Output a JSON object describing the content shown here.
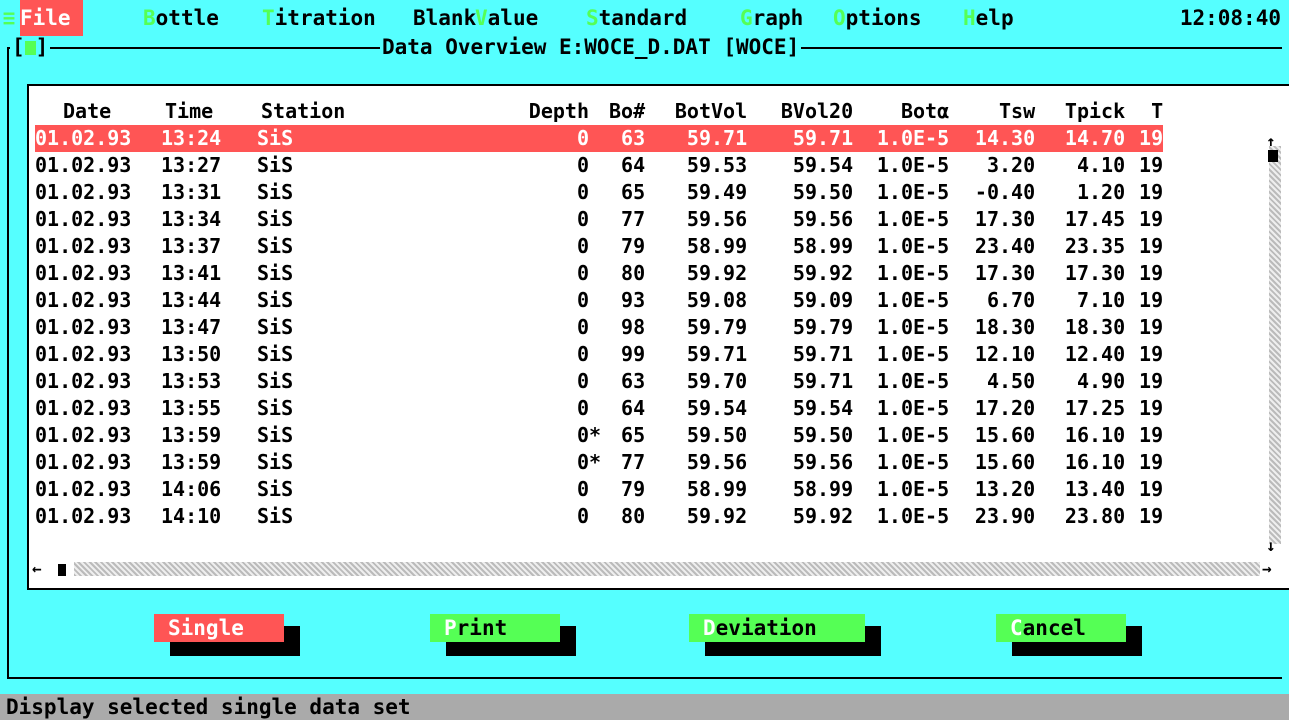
{
  "menu": {
    "sys_icon": "≡",
    "items": [
      {
        "hot": " ",
        "label": "File ",
        "active": true
      },
      {
        "hot": "B",
        "label": "ottle"
      },
      {
        "hot": "T",
        "label": "itration"
      },
      {
        "hot": "",
        "label": "Blank"
      },
      {
        "hot": "V",
        "label": "alue"
      },
      {
        "hot": "S",
        "label": "tandard"
      },
      {
        "hot": "G",
        "label": "raph"
      },
      {
        "hot": "O",
        "label": "ptions"
      },
      {
        "hot": "H",
        "label": "elp"
      }
    ],
    "clock": "12:08:40"
  },
  "dialog": {
    "title": "Data Overview E:WOCE_D.DAT [WOCE]"
  },
  "table": {
    "headers": [
      "Date",
      "Time",
      "Station",
      "Depth",
      "Bo#",
      "BotVol",
      "BVol20",
      "Botα",
      "Tsw",
      "Tpick",
      "T"
    ],
    "rows": [
      {
        "date": "01.02.93",
        "time": "13:24",
        "station": "SiS",
        "depth": "0",
        "flag": "",
        "bo": "63",
        "botvol": "59.71",
        "bvol20": "59.71",
        "bota": "1.0E-5",
        "tsw": "14.30",
        "tpick": "14.70",
        "t": "19"
      },
      {
        "date": "01.02.93",
        "time": "13:27",
        "station": "SiS",
        "depth": "0",
        "flag": "",
        "bo": "64",
        "botvol": "59.53",
        "bvol20": "59.54",
        "bota": "1.0E-5",
        "tsw": "3.20",
        "tpick": "4.10",
        "t": "19"
      },
      {
        "date": "01.02.93",
        "time": "13:31",
        "station": "SiS",
        "depth": "0",
        "flag": "",
        "bo": "65",
        "botvol": "59.49",
        "bvol20": "59.50",
        "bota": "1.0E-5",
        "tsw": "-0.40",
        "tpick": "1.20",
        "t": "19"
      },
      {
        "date": "01.02.93",
        "time": "13:34",
        "station": "SiS",
        "depth": "0",
        "flag": "",
        "bo": "77",
        "botvol": "59.56",
        "bvol20": "59.56",
        "bota": "1.0E-5",
        "tsw": "17.30",
        "tpick": "17.45",
        "t": "19"
      },
      {
        "date": "01.02.93",
        "time": "13:37",
        "station": "SiS",
        "depth": "0",
        "flag": "",
        "bo": "79",
        "botvol": "58.99",
        "bvol20": "58.99",
        "bota": "1.0E-5",
        "tsw": "23.40",
        "tpick": "23.35",
        "t": "19"
      },
      {
        "date": "01.02.93",
        "time": "13:41",
        "station": "SiS",
        "depth": "0",
        "flag": "",
        "bo": "80",
        "botvol": "59.92",
        "bvol20": "59.92",
        "bota": "1.0E-5",
        "tsw": "17.30",
        "tpick": "17.30",
        "t": "19"
      },
      {
        "date": "01.02.93",
        "time": "13:44",
        "station": "SiS",
        "depth": "0",
        "flag": "",
        "bo": "93",
        "botvol": "59.08",
        "bvol20": "59.09",
        "bota": "1.0E-5",
        "tsw": "6.70",
        "tpick": "7.10",
        "t": "19"
      },
      {
        "date": "01.02.93",
        "time": "13:47",
        "station": "SiS",
        "depth": "0",
        "flag": "",
        "bo": "98",
        "botvol": "59.79",
        "bvol20": "59.79",
        "bota": "1.0E-5",
        "tsw": "18.30",
        "tpick": "18.30",
        "t": "19"
      },
      {
        "date": "01.02.93",
        "time": "13:50",
        "station": "SiS",
        "depth": "0",
        "flag": "",
        "bo": "99",
        "botvol": "59.71",
        "bvol20": "59.71",
        "bota": "1.0E-5",
        "tsw": "12.10",
        "tpick": "12.40",
        "t": "19"
      },
      {
        "date": "01.02.93",
        "time": "13:53",
        "station": "SiS",
        "depth": "0",
        "flag": "",
        "bo": "63",
        "botvol": "59.70",
        "bvol20": "59.71",
        "bota": "1.0E-5",
        "tsw": "4.50",
        "tpick": "4.90",
        "t": "19"
      },
      {
        "date": "01.02.93",
        "time": "13:55",
        "station": "SiS",
        "depth": "0",
        "flag": "",
        "bo": "64",
        "botvol": "59.54",
        "bvol20": "59.54",
        "bota": "1.0E-5",
        "tsw": "17.20",
        "tpick": "17.25",
        "t": "19"
      },
      {
        "date": "01.02.93",
        "time": "13:59",
        "station": "SiS",
        "depth": "0",
        "flag": "*",
        "bo": "65",
        "botvol": "59.50",
        "bvol20": "59.50",
        "bota": "1.0E-5",
        "tsw": "15.60",
        "tpick": "16.10",
        "t": "19"
      },
      {
        "date": "01.02.93",
        "time": "13:59",
        "station": "SiS",
        "depth": "0",
        "flag": "*",
        "bo": "77",
        "botvol": "59.56",
        "bvol20": "59.56",
        "bota": "1.0E-5",
        "tsw": "15.60",
        "tpick": "16.10",
        "t": "19"
      },
      {
        "date": "01.02.93",
        "time": "14:06",
        "station": "SiS",
        "depth": "0",
        "flag": "",
        "bo": "79",
        "botvol": "58.99",
        "bvol20": "58.99",
        "bota": "1.0E-5",
        "tsw": "13.20",
        "tpick": "13.40",
        "t": "19"
      },
      {
        "date": "01.02.93",
        "time": "14:10",
        "station": "SiS",
        "depth": "0",
        "flag": "",
        "bo": "80",
        "botvol": "59.92",
        "bvol20": "59.92",
        "bota": "1.0E-5",
        "tsw": "23.90",
        "tpick": "23.80",
        "t": "19"
      }
    ],
    "selected_index": 0
  },
  "buttons": {
    "single": "Single",
    "print_hot": "P",
    "print_rest": "rint",
    "deviation_hot": "D",
    "deviation_rest": "eviation",
    "cancel_hot": "C",
    "cancel_rest": "ancel"
  },
  "status": {
    "text": "Display selected single data set"
  },
  "colors": {
    "background": "#55FFFF",
    "selection": "#FF5555",
    "button_green": "#55FF55",
    "statusbar": "#AAAAAA"
  }
}
